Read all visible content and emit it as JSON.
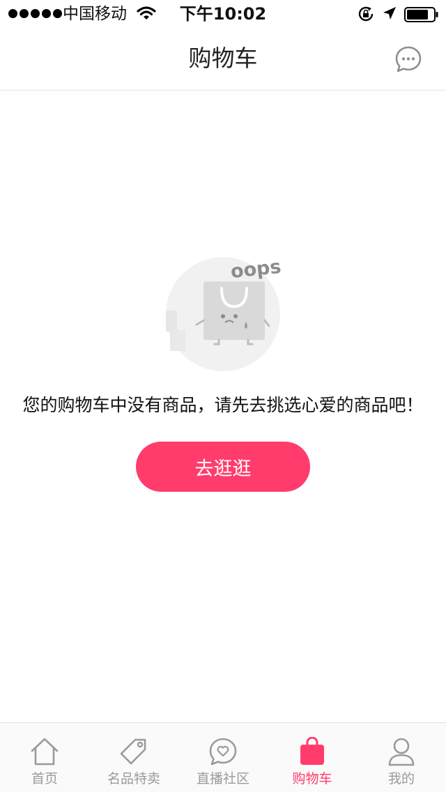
{
  "status_bar": {
    "carrier": "中国移动",
    "time": "下午10:02"
  },
  "nav": {
    "title": "购物车",
    "right_icon": "message-icon"
  },
  "empty_state": {
    "illustration_text": "oops",
    "message": "您的购物车中没有商品，请先去挑选心爱的商品吧！",
    "button_label": "去逛逛"
  },
  "tabs": [
    {
      "label": "首页",
      "icon": "home-icon",
      "active": false
    },
    {
      "label": "名品特卖",
      "icon": "tag-icon",
      "active": false
    },
    {
      "label": "直播社区",
      "icon": "heart-chat-icon",
      "active": false
    },
    {
      "label": "购物车",
      "icon": "shopping-bag-icon",
      "active": true
    },
    {
      "label": "我的",
      "icon": "user-icon",
      "active": false
    }
  ],
  "colors": {
    "accent": "#ff3c6c",
    "tab_inactive": "#9a9a9a",
    "illustration_bg": "#f1f1f1"
  }
}
